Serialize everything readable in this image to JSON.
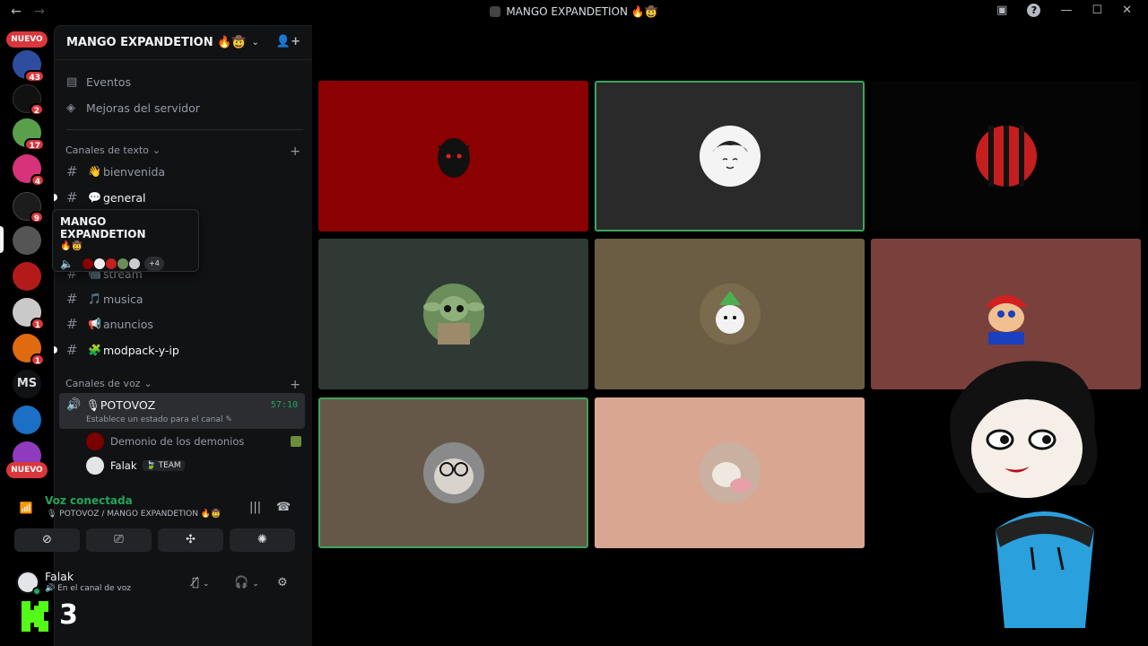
{
  "titlebar": {
    "back_icon": "arrow-left-icon",
    "forward_icon": "arrow-right-icon",
    "title": "MANGO EXPANDETION 🔥🤠"
  },
  "rail": {
    "nuevo_label": "NUEVO",
    "badges": [
      "43",
      "2",
      "17",
      "4",
      "9",
      "1",
      "1",
      "1"
    ],
    "ms_label": "MS"
  },
  "guild": {
    "name": "MANGO EXPANDETION 🔥🤠",
    "top_items": [
      "Eventos",
      "Mejoras del servidor"
    ]
  },
  "text_category": "Canales de texto",
  "text_channels": [
    {
      "emoji": "👋",
      "name": "bienvenida"
    },
    {
      "emoji": "💬",
      "name": "general"
    },
    {
      "emoji": "📹",
      "name": "stream"
    },
    {
      "emoji": "🎵",
      "name": "musica"
    },
    {
      "emoji": "📢",
      "name": "anuncios"
    },
    {
      "emoji": "🧩",
      "name": "modpack-y-ip"
    }
  ],
  "tooltip": {
    "title": "MANGO EXPANDETION",
    "emoji": "🔥🤠",
    "more": "+4"
  },
  "voice_category": "Canales de voz",
  "voice_channel": {
    "name": "POTOVOZ",
    "time": "57:10",
    "status": "Establece un estado para el canal"
  },
  "voice_members": [
    {
      "name": "Demonio de los demonios",
      "tag": ""
    },
    {
      "name": "Falak",
      "tag": "TEAM"
    }
  ],
  "voice_panel": {
    "connected": "Voz conectada",
    "location": "POTOVOZ / MANGO EXPANDETION 🔥🤠"
  },
  "user": {
    "name": "Falak",
    "status": "En el canal de voz"
  },
  "overlay": {
    "count": "3"
  },
  "colors": {
    "accent_green": "#23a55a",
    "badge_red": "#da373c"
  }
}
